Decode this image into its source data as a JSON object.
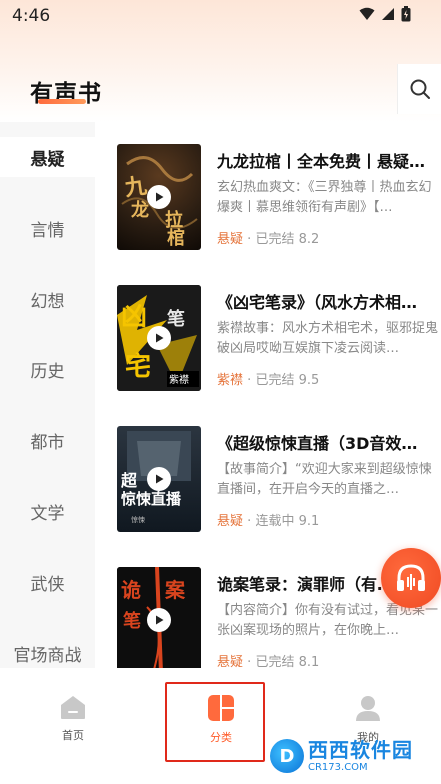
{
  "status_bar": {
    "time": "4:46"
  },
  "header": {
    "title": "有声书"
  },
  "sidebar": {
    "items": [
      {
        "label": "悬疑",
        "active": true
      },
      {
        "label": "言情",
        "active": false
      },
      {
        "label": "幻想",
        "active": false
      },
      {
        "label": "历史",
        "active": false
      },
      {
        "label": "都市",
        "active": false
      },
      {
        "label": "文学",
        "active": false
      },
      {
        "label": "武侠",
        "active": false
      },
      {
        "label": "官场商战",
        "active": false
      }
    ]
  },
  "books": [
    {
      "title": "九龙拉棺丨全本免费丨悬疑…",
      "description": "玄幻热血爽文：《三界独尊丨热血玄幻爆爽丨慕思维领衔有声剧》【…",
      "tag": "悬疑",
      "status": "已完结",
      "rating": "8.2",
      "cover_text": "九龙拉棺",
      "cover_colors": [
        "#2a1d12",
        "#8b5a2b"
      ]
    },
    {
      "title": "《凶宅笔录》（风水方术相…",
      "description": "紫襟故事：风水方术相宅术，驱邪捉鬼破凶局哎呦互娱旗下凌云阅读…",
      "tag": "紫襟",
      "status": "已完结",
      "rating": "9.5",
      "cover_text": "凶宅",
      "cover_colors": [
        "#1a1a1a",
        "#f5c400"
      ]
    },
    {
      "title": "《超级惊悚直播（3D音效…",
      "description": "【故事简介】“欢迎大家来到超级惊悚直播间，在开启今天的直播之…",
      "tag": "悬疑",
      "status": "连载中",
      "rating": "9.1",
      "cover_text": "超级惊悚直播",
      "cover_colors": [
        "#101820",
        "#4a5866"
      ]
    },
    {
      "title": "诡案笔录：演罪师（有…",
      "description": "【内容简介】你有没有试过，看见某一张凶案现场的照片，在你晚上…",
      "tag": "悬疑",
      "status": "已完结",
      "rating": "8.1",
      "cover_text": "诡案笔录",
      "cover_colors": [
        "#0d0d0d",
        "#d9441e"
      ]
    }
  ],
  "meta_separator": "·",
  "bottom_nav": {
    "items": [
      {
        "label": "首页",
        "icon": "home-icon",
        "active": false
      },
      {
        "label": "分类",
        "icon": "category-icon",
        "active": true
      },
      {
        "label": "我的",
        "icon": "profile-icon",
        "active": false
      }
    ]
  },
  "watermark": {
    "logo_letter": "D",
    "name": "西西软件园",
    "url": "CR173.COM"
  },
  "colors": {
    "accent": "#ff5c2a",
    "tag": "#e5743b",
    "sidebar_bg": "#f7f7f7"
  }
}
